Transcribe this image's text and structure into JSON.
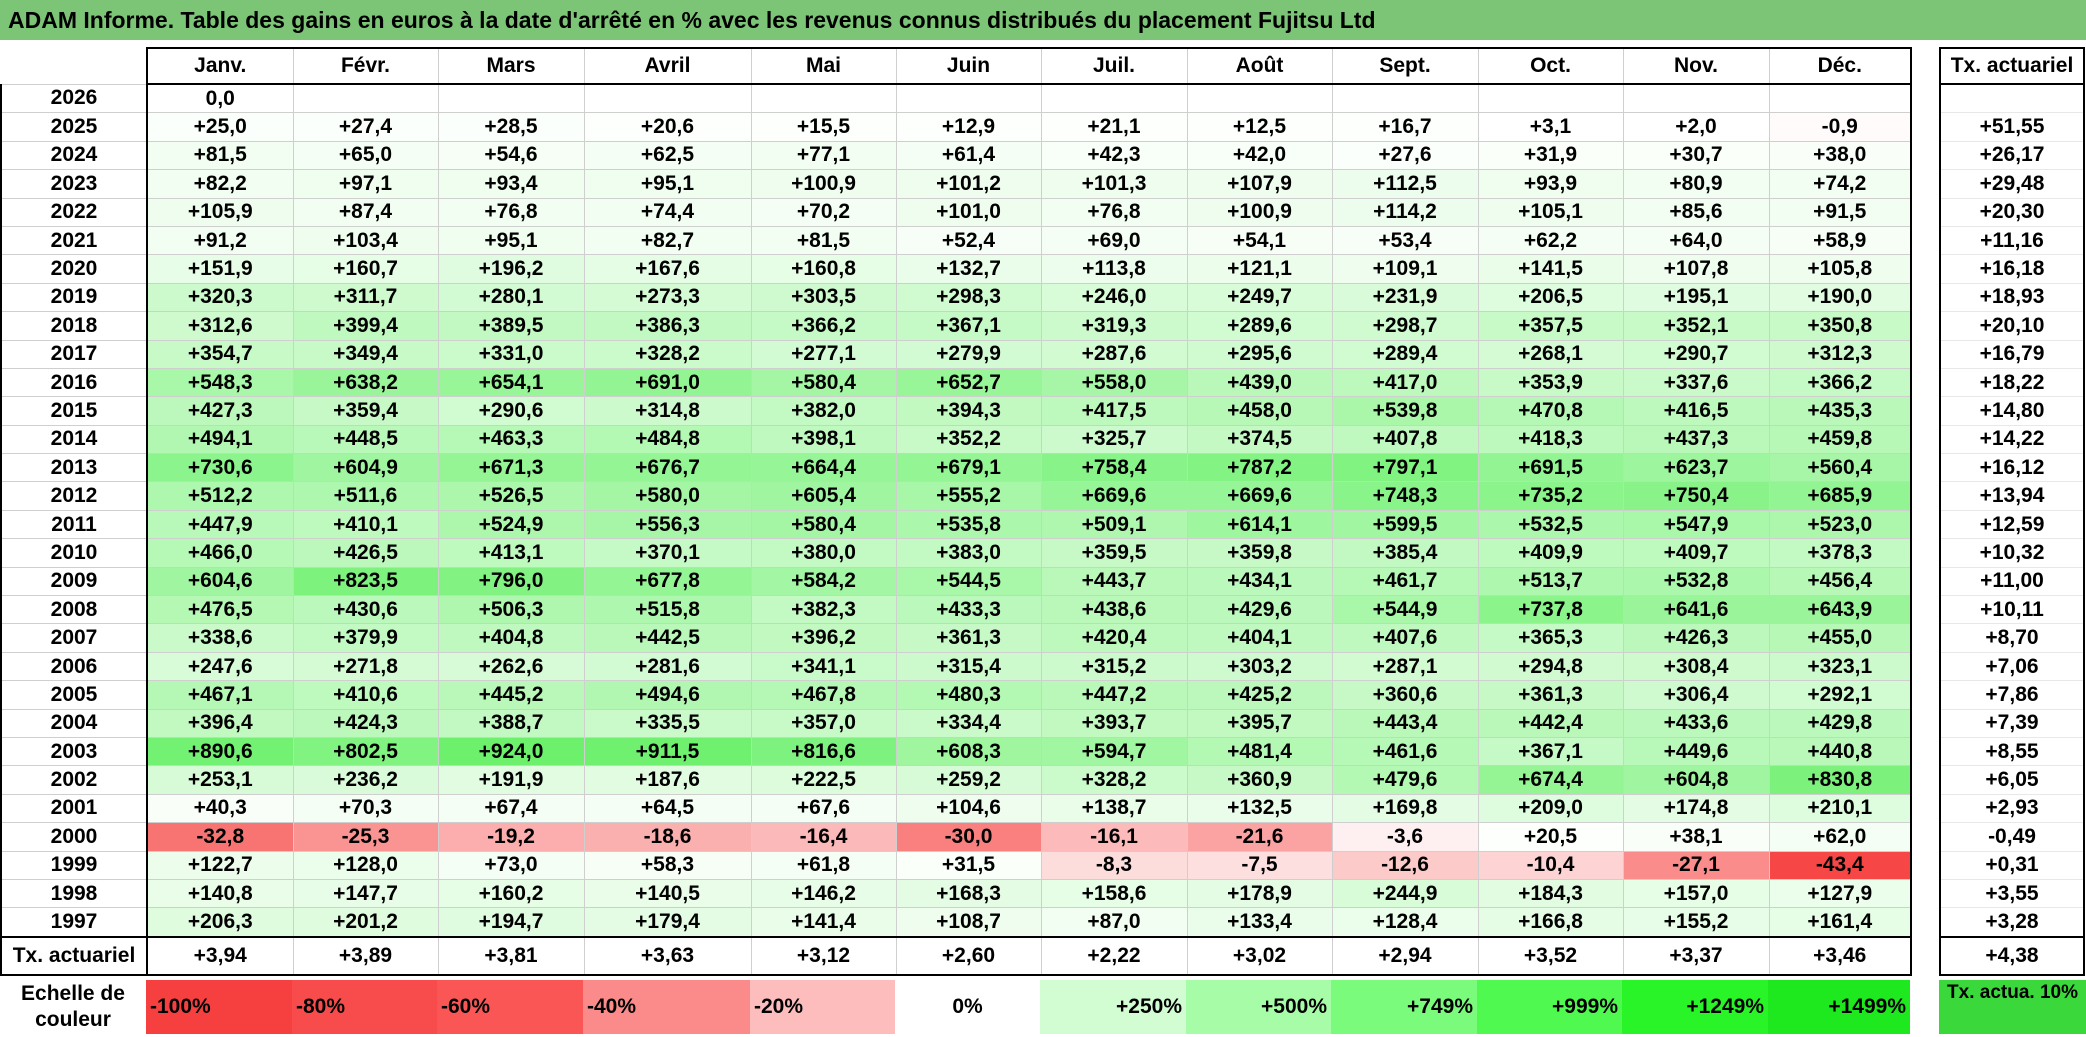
{
  "title": "ADAM Informe. Table des gains en euros à la date d'arrêté en % avec les revenus connus distribués du placement Fujitsu Ltd",
  "months": [
    "Janv.",
    "Févr.",
    "Mars",
    "Avril",
    "Mai",
    "Juin",
    "Juil.",
    "Août",
    "Sept.",
    "Oct.",
    "Nov.",
    "Déc."
  ],
  "actuarial_header": "Tx. actuariel",
  "summary_label": "Tx. actuariel",
  "rows": [
    {
      "year": "2026",
      "values": [
        "0,0",
        "",
        "",
        "",
        "",
        "",
        "",
        "",
        "",
        "",
        "",
        ""
      ],
      "act": ""
    },
    {
      "year": "2025",
      "values": [
        "+25,0",
        "+27,4",
        "+28,5",
        "+20,6",
        "+15,5",
        "+12,9",
        "+21,1",
        "+12,5",
        "+16,7",
        "+3,1",
        "+2,0",
        "-0,9"
      ],
      "act": "+51,55"
    },
    {
      "year": "2024",
      "values": [
        "+81,5",
        "+65,0",
        "+54,6",
        "+62,5",
        "+77,1",
        "+61,4",
        "+42,3",
        "+42,0",
        "+27,6",
        "+31,9",
        "+30,7",
        "+38,0"
      ],
      "act": "+26,17"
    },
    {
      "year": "2023",
      "values": [
        "+82,2",
        "+97,1",
        "+93,4",
        "+95,1",
        "+100,9",
        "+101,2",
        "+101,3",
        "+107,9",
        "+112,5",
        "+93,9",
        "+80,9",
        "+74,2"
      ],
      "act": "+29,48"
    },
    {
      "year": "2022",
      "values": [
        "+105,9",
        "+87,4",
        "+76,8",
        "+74,4",
        "+70,2",
        "+101,0",
        "+76,8",
        "+100,9",
        "+114,2",
        "+105,1",
        "+85,6",
        "+91,5"
      ],
      "act": "+20,30"
    },
    {
      "year": "2021",
      "values": [
        "+91,2",
        "+103,4",
        "+95,1",
        "+82,7",
        "+81,5",
        "+52,4",
        "+69,0",
        "+54,1",
        "+53,4",
        "+62,2",
        "+64,0",
        "+58,9"
      ],
      "act": "+11,16"
    },
    {
      "year": "2020",
      "values": [
        "+151,9",
        "+160,7",
        "+196,2",
        "+167,6",
        "+160,8",
        "+132,7",
        "+113,8",
        "+121,1",
        "+109,1",
        "+141,5",
        "+107,8",
        "+105,8"
      ],
      "act": "+16,18"
    },
    {
      "year": "2019",
      "values": [
        "+320,3",
        "+311,7",
        "+280,1",
        "+273,3",
        "+303,5",
        "+298,3",
        "+246,0",
        "+249,7",
        "+231,9",
        "+206,5",
        "+195,1",
        "+190,0"
      ],
      "act": "+18,93"
    },
    {
      "year": "2018",
      "values": [
        "+312,6",
        "+399,4",
        "+389,5",
        "+386,3",
        "+366,2",
        "+367,1",
        "+319,3",
        "+289,6",
        "+298,7",
        "+357,5",
        "+352,1",
        "+350,8"
      ],
      "act": "+20,10"
    },
    {
      "year": "2017",
      "values": [
        "+354,7",
        "+349,4",
        "+331,0",
        "+328,2",
        "+277,1",
        "+279,9",
        "+287,6",
        "+295,6",
        "+289,4",
        "+268,1",
        "+290,7",
        "+312,3"
      ],
      "act": "+16,79"
    },
    {
      "year": "2016",
      "values": [
        "+548,3",
        "+638,2",
        "+654,1",
        "+691,0",
        "+580,4",
        "+652,7",
        "+558,0",
        "+439,0",
        "+417,0",
        "+353,9",
        "+337,6",
        "+366,2"
      ],
      "act": "+18,22"
    },
    {
      "year": "2015",
      "values": [
        "+427,3",
        "+359,4",
        "+290,6",
        "+314,8",
        "+382,0",
        "+394,3",
        "+417,5",
        "+458,0",
        "+539,8",
        "+470,8",
        "+416,5",
        "+435,3"
      ],
      "act": "+14,80"
    },
    {
      "year": "2014",
      "values": [
        "+494,1",
        "+448,5",
        "+463,3",
        "+484,8",
        "+398,1",
        "+352,2",
        "+325,7",
        "+374,5",
        "+407,8",
        "+418,3",
        "+437,3",
        "+459,8"
      ],
      "act": "+14,22"
    },
    {
      "year": "2013",
      "values": [
        "+730,6",
        "+604,9",
        "+671,3",
        "+676,7",
        "+664,4",
        "+679,1",
        "+758,4",
        "+787,2",
        "+797,1",
        "+691,5",
        "+623,7",
        "+560,4"
      ],
      "act": "+16,12"
    },
    {
      "year": "2012",
      "values": [
        "+512,2",
        "+511,6",
        "+526,5",
        "+580,0",
        "+605,4",
        "+555,2",
        "+669,6",
        "+669,6",
        "+748,3",
        "+735,2",
        "+750,4",
        "+685,9"
      ],
      "act": "+13,94"
    },
    {
      "year": "2011",
      "values": [
        "+447,9",
        "+410,1",
        "+524,9",
        "+556,3",
        "+580,4",
        "+535,8",
        "+509,1",
        "+614,1",
        "+599,5",
        "+532,5",
        "+547,9",
        "+523,0"
      ],
      "act": "+12,59"
    },
    {
      "year": "2010",
      "values": [
        "+466,0",
        "+426,5",
        "+413,1",
        "+370,1",
        "+380,0",
        "+383,0",
        "+359,5",
        "+359,8",
        "+385,4",
        "+409,9",
        "+409,7",
        "+378,3"
      ],
      "act": "+10,32"
    },
    {
      "year": "2009",
      "values": [
        "+604,6",
        "+823,5",
        "+796,0",
        "+677,8",
        "+584,2",
        "+544,5",
        "+443,7",
        "+434,1",
        "+461,7",
        "+513,7",
        "+532,8",
        "+456,4"
      ],
      "act": "+11,00"
    },
    {
      "year": "2008",
      "values": [
        "+476,5",
        "+430,6",
        "+506,3",
        "+515,8",
        "+382,3",
        "+433,3",
        "+438,6",
        "+429,6",
        "+544,9",
        "+737,8",
        "+641,6",
        "+643,9"
      ],
      "act": "+10,11"
    },
    {
      "year": "2007",
      "values": [
        "+338,6",
        "+379,9",
        "+404,8",
        "+442,5",
        "+396,2",
        "+361,3",
        "+420,4",
        "+404,1",
        "+407,6",
        "+365,3",
        "+426,3",
        "+455,0"
      ],
      "act": "+8,70"
    },
    {
      "year": "2006",
      "values": [
        "+247,6",
        "+271,8",
        "+262,6",
        "+281,6",
        "+341,1",
        "+315,4",
        "+315,2",
        "+303,2",
        "+287,1",
        "+294,8",
        "+308,4",
        "+323,1"
      ],
      "act": "+7,06"
    },
    {
      "year": "2005",
      "values": [
        "+467,1",
        "+410,6",
        "+445,2",
        "+494,6",
        "+467,8",
        "+480,3",
        "+447,2",
        "+425,2",
        "+360,6",
        "+361,3",
        "+306,4",
        "+292,1"
      ],
      "act": "+7,86"
    },
    {
      "year": "2004",
      "values": [
        "+396,4",
        "+424,3",
        "+388,7",
        "+335,5",
        "+357,0",
        "+334,4",
        "+393,7",
        "+395,7",
        "+443,4",
        "+442,4",
        "+433,6",
        "+429,8"
      ],
      "act": "+7,39"
    },
    {
      "year": "2003",
      "values": [
        "+890,6",
        "+802,5",
        "+924,0",
        "+911,5",
        "+816,6",
        "+608,3",
        "+594,7",
        "+481,4",
        "+461,6",
        "+367,1",
        "+449,6",
        "+440,8"
      ],
      "act": "+8,55"
    },
    {
      "year": "2002",
      "values": [
        "+253,1",
        "+236,2",
        "+191,9",
        "+187,6",
        "+222,5",
        "+259,2",
        "+328,2",
        "+360,9",
        "+479,6",
        "+674,4",
        "+604,8",
        "+830,8"
      ],
      "act": "+6,05"
    },
    {
      "year": "2001",
      "values": [
        "+40,3",
        "+70,3",
        "+67,4",
        "+64,5",
        "+67,6",
        "+104,6",
        "+138,7",
        "+132,5",
        "+169,8",
        "+209,0",
        "+174,8",
        "+210,1"
      ],
      "act": "+2,93"
    },
    {
      "year": "2000",
      "values": [
        "-32,8",
        "-25,3",
        "-19,2",
        "-18,6",
        "-16,4",
        "-30,0",
        "-16,1",
        "-21,6",
        "-3,6",
        "+20,5",
        "+38,1",
        "+62,0"
      ],
      "act": "-0,49"
    },
    {
      "year": "1999",
      "values": [
        "+122,7",
        "+128,0",
        "+73,0",
        "+58,3",
        "+61,8",
        "+31,5",
        "-8,3",
        "-7,5",
        "-12,6",
        "-10,4",
        "-27,1",
        "-43,4"
      ],
      "act": "+0,31"
    },
    {
      "year": "1998",
      "values": [
        "+140,8",
        "+147,7",
        "+160,2",
        "+140,5",
        "+146,2",
        "+168,3",
        "+158,6",
        "+178,9",
        "+244,9",
        "+184,3",
        "+157,0",
        "+127,9"
      ],
      "act": "+3,55"
    },
    {
      "year": "1997",
      "values": [
        "+206,3",
        "+201,2",
        "+194,7",
        "+179,4",
        "+141,4",
        "+108,7",
        "+87,0",
        "+133,4",
        "+128,4",
        "+166,8",
        "+155,2",
        "+161,4"
      ],
      "act": "+3,28"
    }
  ],
  "monthly_actuarial": [
    "+3,94",
    "+3,89",
    "+3,81",
    "+3,63",
    "+3,12",
    "+2,60",
    "+2,22",
    "+3,02",
    "+2,94",
    "+3,52",
    "+3,37",
    "+3,46"
  ],
  "overall_actuarial": "+4,38",
  "scale": {
    "label": "Echelle de couleur",
    "stops": [
      {
        "label": "-100%",
        "color": "#f6403f",
        "align": "left"
      },
      {
        "label": "-80%",
        "color": "#f84b4b",
        "align": "left"
      },
      {
        "label": "-60%",
        "color": "#fa5656",
        "align": "left"
      },
      {
        "label": "-40%",
        "color": "#fb8a8a",
        "align": "left"
      },
      {
        "label": "-20%",
        "color": "#fdbdbd",
        "align": "left"
      },
      {
        "label": "0%",
        "color": "#ffffff",
        "align": "center"
      },
      {
        "label": "+250%",
        "color": "#d2fdd2",
        "align": "right"
      },
      {
        "label": "+500%",
        "color": "#a7fca7",
        "align": "right"
      },
      {
        "label": "+749%",
        "color": "#7bfb7b",
        "align": "right"
      },
      {
        "label": "+999%",
        "color": "#50f950",
        "align": "right"
      },
      {
        "label": "+1249%",
        "color": "#28f428",
        "align": "right"
      },
      {
        "label": "+1499%",
        "color": "#1ee81e",
        "align": "right"
      }
    ],
    "extra_label": "Tx. actua. 10%",
    "extra_color": "#3bd83b"
  }
}
